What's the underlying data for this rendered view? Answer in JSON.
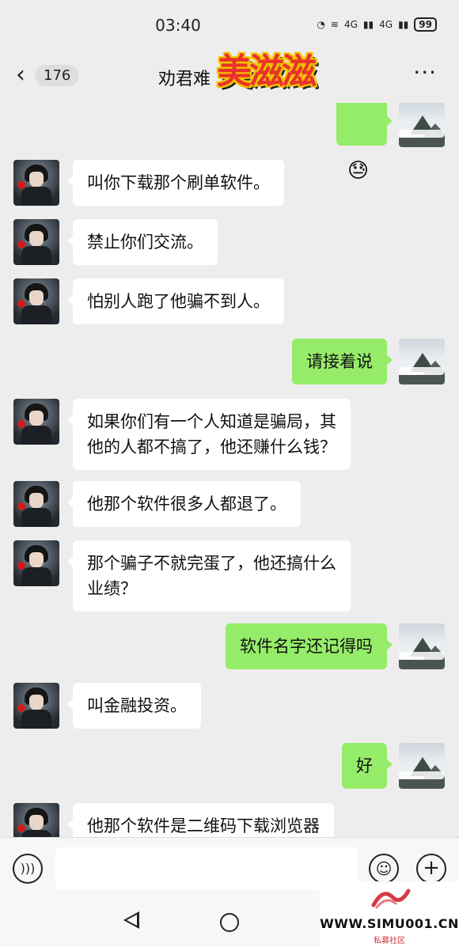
{
  "status_bar": {
    "time": "03:40",
    "net1": "4G",
    "net2": "4G",
    "battery": "99"
  },
  "header": {
    "unread_count": "176",
    "title": "劝君难",
    "sticker_text": "美滋滋"
  },
  "messages": [
    {
      "side": "out",
      "type": "emoji",
      "text": "😓"
    },
    {
      "side": "in",
      "type": "text",
      "text": "叫你下载那个刷单软件。"
    },
    {
      "side": "in",
      "type": "text",
      "text": "禁止你们交流。"
    },
    {
      "side": "in",
      "type": "text",
      "text": "怕别人跑了他骗不到人。"
    },
    {
      "side": "out",
      "type": "text",
      "text": "请接着说"
    },
    {
      "side": "in",
      "type": "text",
      "text": "如果你们有一个人知道是骗局，其\n他的人都不搞了，他还赚什么钱？"
    },
    {
      "side": "in",
      "type": "text",
      "text": "他那个软件很多人都退了。"
    },
    {
      "side": "in",
      "type": "text",
      "text": "那个骗子不就完蛋了，他还搞什么\n业绩？"
    },
    {
      "side": "out",
      "type": "text",
      "text": "软件名字还记得吗"
    },
    {
      "side": "in",
      "type": "text",
      "text": "叫金融投资。"
    },
    {
      "side": "out",
      "type": "text",
      "text": "好"
    },
    {
      "side": "in",
      "type": "text",
      "text": "他那个软件是二维码下载浏览器"
    }
  ],
  "input_bar": {
    "placeholder": ""
  },
  "watermark": {
    "url": "WWW.SIMU001.CN",
    "subtitle": "私募社区"
  },
  "colors": {
    "background": "#ededed",
    "bubble_out": "#95ec69",
    "bubble_in": "#ffffff"
  },
  "icons": {
    "back": "chevron-left-icon",
    "more": "more-dots-icon",
    "voice": "voice-icon",
    "emoji": "emoji-icon",
    "plus": "plus-icon"
  }
}
